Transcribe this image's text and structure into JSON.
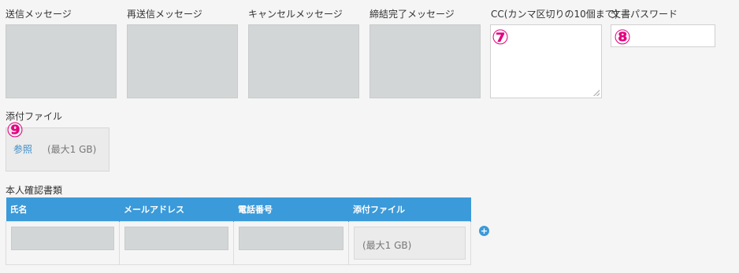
{
  "fields": {
    "send_message": "送信メッセージ",
    "resend_message": "再送信メッセージ",
    "cancel_message": "キャンセルメッセージ",
    "complete_message": "締結完了メッセージ",
    "cc": "CC(カンマ区切りの10個まで)",
    "doc_password": "文書パスワード",
    "attachment": "添付ファイル",
    "browse": "参照",
    "max_size": "(最大1 GB)"
  },
  "markers": {
    "m7": "⑦",
    "m8": "⑧",
    "m9": "⑨"
  },
  "identity": {
    "section_label": "本人確認書類",
    "columns": [
      "氏名",
      "メールアドレス",
      "電話番号",
      "添付ファイル"
    ],
    "attachment_hint": "(最大1 GB)",
    "add_symbol": "+"
  },
  "colors": {
    "header_blue": "#3b9ad9",
    "marker_pink": "#e4007f",
    "link_blue": "#3c8dc8"
  }
}
